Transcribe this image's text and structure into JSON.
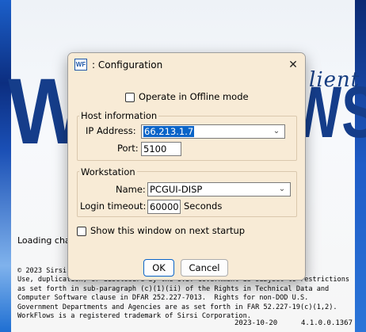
{
  "splash": {
    "brand_client": "lient",
    "brand_w": "W",
    "brand_ws": "WS",
    "loading_text": "Loading cha",
    "legal_lines": [
      "© 2023 Sirsi",
      "Use, duplication, or disclosure by the U.S. Government is subject to restrictions",
      "as set forth in sub-paragraph (c)(1)(ii) of the Rights in Technical Data and",
      "Computer Software clause in DFAR 252.227-7013.  Rights for non-DOD U.S.",
      "Government Departments and Agencies are as set forth in FAR 52.227-19(c)(1,2).",
      "WorkFlows is a registered trademark of Sirsi Corporation."
    ],
    "build_date": "2023-10-20",
    "build_version": "4.1.0.0.1367"
  },
  "dialog": {
    "icon_text": "WF",
    "title": ": Configuration",
    "close_icon": "close-icon",
    "offline_label": "Operate in Offline mode",
    "offline_checked": false,
    "host": {
      "title": "Host information",
      "ip_label": "IP Address:",
      "ip_value": "66.213.1.7",
      "port_label": "Port:",
      "port_value": "5100"
    },
    "workstation": {
      "title": "Workstation",
      "name_label": "Name:",
      "name_value": "PCGUI-DISP",
      "timeout_label": "Login timeout:",
      "timeout_value": "60000",
      "timeout_unit": "Seconds"
    },
    "startup_label": "Show this window on next startup",
    "startup_checked": false,
    "ok_label": "OK",
    "cancel_label": "Cancel"
  },
  "colors": {
    "dialog_bg": "#f8ebd6",
    "brand_blue": "#153d8a",
    "selection": "#0a64c8"
  }
}
